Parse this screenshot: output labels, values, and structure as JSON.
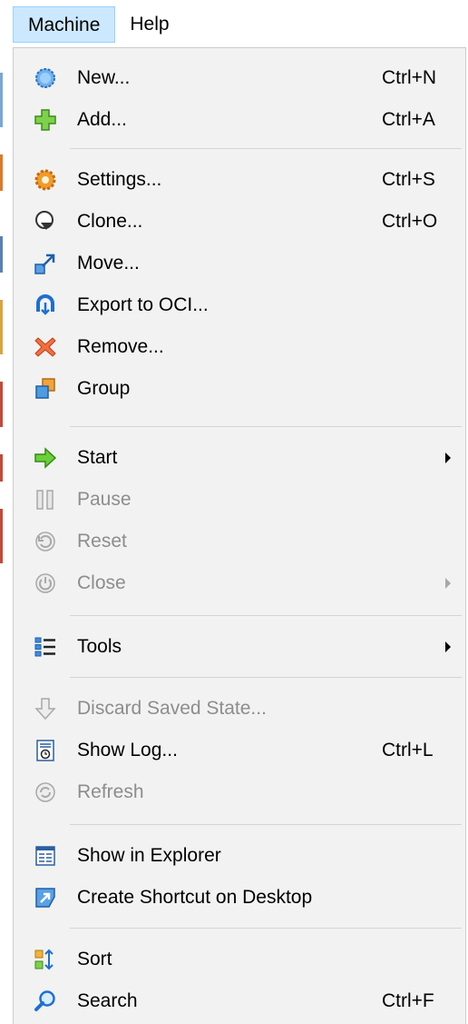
{
  "menubar": {
    "items": [
      {
        "label": "Machine"
      },
      {
        "label": "Help"
      }
    ]
  },
  "machine_menu": {
    "new": {
      "label": "New...",
      "shortcut": "Ctrl+N"
    },
    "add": {
      "label": "Add...",
      "shortcut": "Ctrl+A"
    },
    "settings": {
      "label": "Settings...",
      "shortcut": "Ctrl+S"
    },
    "clone": {
      "label": "Clone...",
      "shortcut": "Ctrl+O"
    },
    "move": {
      "label": "Move..."
    },
    "export_oci": {
      "label": "Export to OCI..."
    },
    "remove": {
      "label": "Remove..."
    },
    "group": {
      "label": "Group"
    },
    "start": {
      "label": "Start"
    },
    "pause": {
      "label": "Pause"
    },
    "reset": {
      "label": "Reset"
    },
    "close": {
      "label": "Close"
    },
    "tools": {
      "label": "Tools"
    },
    "discard": {
      "label": "Discard Saved State..."
    },
    "show_log": {
      "label": "Show Log...",
      "shortcut": "Ctrl+L"
    },
    "refresh": {
      "label": "Refresh"
    },
    "show_explorer": {
      "label": "Show in Explorer"
    },
    "shortcut_desktop": {
      "label": "Create Shortcut on Desktop"
    },
    "sort": {
      "label": "Sort"
    },
    "search": {
      "label": "Search",
      "shortcut": "Ctrl+F"
    }
  },
  "colors": {
    "menubar_active_bg": "#cce8ff",
    "menubar_active_border": "#99d1ff",
    "menu_bg": "#f2f2f2",
    "disabled_text": "#8d8d8d"
  }
}
